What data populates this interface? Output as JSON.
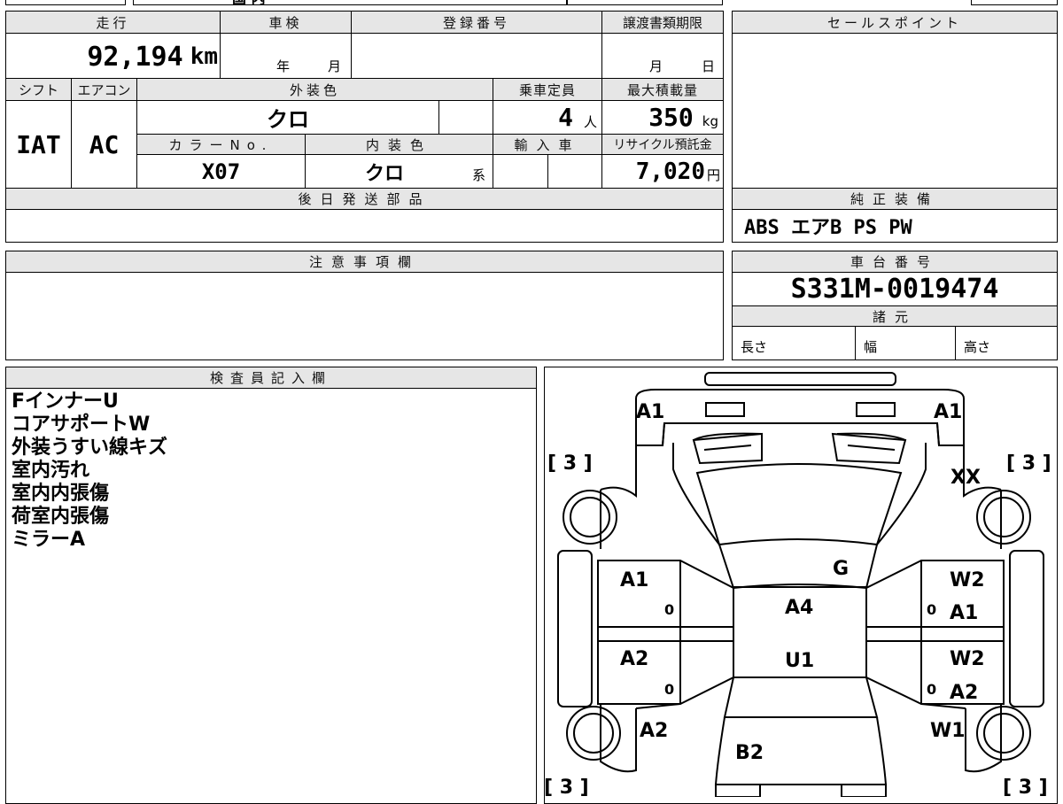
{
  "top_strip": {
    "partial_text": "国 内"
  },
  "mileage": {
    "label": "走行",
    "value": "92,194",
    "unit": "km"
  },
  "shaken": {
    "label": "車検",
    "year_label": "年",
    "month_label": "月"
  },
  "registration": {
    "label": "登録番号",
    "value": ""
  },
  "transfer_deadline": {
    "label": "譲渡書類期限",
    "month_label": "月",
    "day_label": "日"
  },
  "sales_point": {
    "label": "セールスポイント",
    "value": ""
  },
  "shift": {
    "label": "シフト",
    "value": "IAT"
  },
  "aircon": {
    "label": "エアコン",
    "value": "AC"
  },
  "exterior_color": {
    "label": "外装色",
    "value": "クロ"
  },
  "capacity": {
    "label": "乗車定員",
    "value": "4",
    "unit": "人"
  },
  "max_load": {
    "label": "最大積載量",
    "value": "350",
    "unit": "kg"
  },
  "color_no": {
    "label": "カラーNo.",
    "value": "X07"
  },
  "interior_color": {
    "label": "内装色",
    "value": "クロ",
    "suffix": "系"
  },
  "import": {
    "label": "輸入車",
    "value": ""
  },
  "recycle_fee": {
    "label": "リサイクル預託金",
    "value": "7,020",
    "unit": "円"
  },
  "later_parts": {
    "label": "後日発送部品",
    "value": ""
  },
  "genuine_equipment": {
    "label": "純正装備",
    "value": "ABS エアB PS PW"
  },
  "caution": {
    "label": "注意事項欄",
    "value": ""
  },
  "chassis_number": {
    "label": "車台番号",
    "value": "S331M-0019474"
  },
  "specs": {
    "label": "諸元",
    "length_label": "長さ",
    "width_label": "幅",
    "height_label": "高さ"
  },
  "inspector": {
    "label": "検査員記入欄",
    "notes": [
      "FインナーU",
      "コアサポートW",
      "外装うすい線キズ",
      "室内汚れ",
      "室内内張傷",
      "荷室内張傷",
      "ミラーA"
    ]
  },
  "diagram": {
    "marks": {
      "front_left": "A1",
      "front_right": "A1",
      "top_left_bracket": "[ 3 ]",
      "top_right_bracket": "[ 3 ]",
      "top_right_xx": "XX",
      "windshield": "G",
      "front_door_left": "A1",
      "front_door_left_small": "0",
      "rear_door_left": "A2",
      "rear_door_left_small": "0",
      "roof_front": "A4",
      "roof_rear": "U1",
      "front_door_right_top": "W2",
      "front_door_right": "A1",
      "front_door_right_small": "0",
      "rear_door_right_top": "W2",
      "rear_door_right": "A2",
      "rear_door_right_small": "0",
      "rear_left": "A2",
      "rear_right": "W1",
      "back": "B2",
      "bottom_left_bracket": "[ 3 ]",
      "bottom_right_bracket": "[ 3 ]"
    }
  }
}
